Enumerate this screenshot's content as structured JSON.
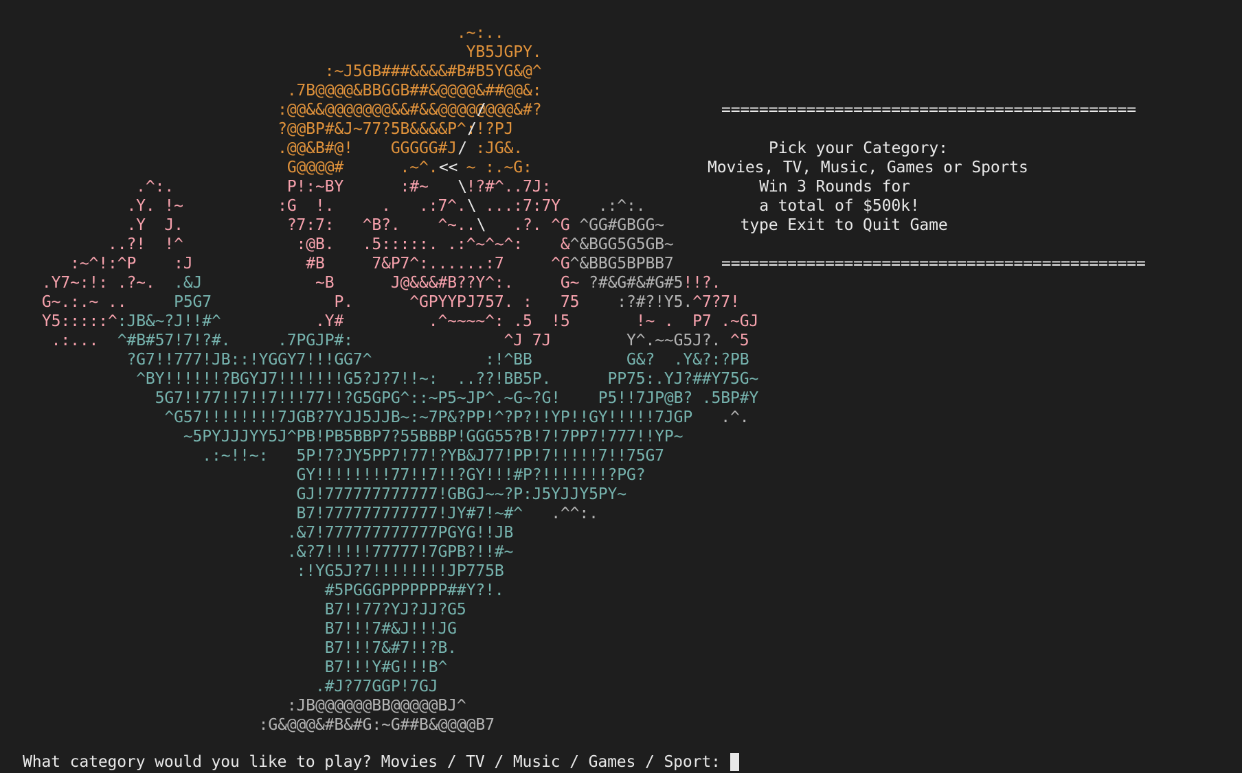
{
  "art_lines": [
    [
      {
        "t": "                                                .~:..",
        "c": "orange"
      }
    ],
    [
      {
        "t": "                                                 YB5JGPY.",
        "c": "orange"
      }
    ],
    [
      {
        "t": "                                  :~J5GB###&&&&#B#B5YG&@^",
        "c": "orange"
      }
    ],
    [
      {
        "t": "                              .7B@@@@&BBGGB##&@@@@&##@@&:",
        "c": "orange"
      }
    ],
    [
      {
        "t": "                             :@@&&@@@@@@@&&#&&@@@@@@@@&#?",
        "c": "orange"
      }
    ],
    [
      {
        "t": "                             ?@@BP#&J~77?5B&&&&P^:!?PJ",
        "c": "orange"
      }
    ],
    [
      {
        "t": "                             .@@&B#@!    GGGGG#J  :JG&.",
        "c": "orange"
      }
    ],
    [
      {
        "t": "                              G@@@@#      .~^.   ~ :.~G:",
        "c": "orange"
      }
    ],
    [
      {
        "t": "              .^:.            P!:~BY      :#~    !?#^..7J:",
        "c": "pink"
      }
    ],
    [
      {
        "t": "             .Y. !~          :G  !.     .   .:7^.  ...:7:7Y    ",
        "c": "pink"
      },
      {
        "t": ".:^:.",
        "c": "grey"
      }
    ],
    [
      {
        "t": "             .Y  J.           ?7:7:   ^B?.    ^~..    .?. ^G ",
        "c": "pink"
      },
      {
        "t": "^GG#GBGG~",
        "c": "grey"
      }
    ],
    [
      {
        "t": "           ..?!  !^            :@B.   .5:::::. .:^~^~^:    &",
        "c": "pink"
      },
      {
        "t": "^&BGG5G5GB~",
        "c": "grey"
      }
    ],
    [
      {
        "t": "       :~^!:^P    :J            #B     7&P7^:......:7     ^G",
        "c": "pink"
      },
      {
        "t": "^&BBG5BPBB7",
        "c": "grey"
      }
    ],
    [
      {
        "t": "    .Y7~:!: .?~.  ",
        "c": "pink"
      },
      {
        "t": ".&J",
        "c": "teal"
      },
      {
        "t": "            ~B      J@&&&#B??Y^:.     G~ ",
        "c": "pink"
      },
      {
        "t": "?#&G#&#G#5",
        "c": "grey"
      },
      {
        "t": "!!?.",
        "c": "pink"
      }
    ],
    [
      {
        "t": "    G~.:.~ ..     ",
        "c": "pink"
      },
      {
        "t": "P5G7",
        "c": "teal"
      },
      {
        "t": "             P.      ^GPYYPJ757. :   75    ",
        "c": "pink"
      },
      {
        "t": ":?#?!Y5.",
        "c": "grey"
      },
      {
        "t": "^7?7!",
        "c": "pink"
      }
    ],
    [
      {
        "t": "    Y5:::::^",
        "c": "pink"
      },
      {
        "t": ":JB&~?J!!#^",
        "c": "teal"
      },
      {
        "t": "          .Y#         .^~~~~^: .5  !5       !~ .  P7 ",
        "c": "pink"
      },
      {
        "t": ".~GJ",
        "c": "pink"
      }
    ],
    [
      {
        "t": "     .:...  ",
        "c": "pink"
      },
      {
        "t": "^#B#57!7!?#.     .7PGJP#:",
        "c": "teal"
      },
      {
        "t": "                ^J 7J        ",
        "c": "pink"
      },
      {
        "t": "Y^.~~G5J?. ",
        "c": "grey"
      },
      {
        "t": "^5",
        "c": "pink"
      }
    ],
    [
      {
        "t": "             ?G7!!777!JB::!YGGY7!!!GG7^            :!^BB          G&?  .Y&?:?PB",
        "c": "teal"
      }
    ],
    [
      {
        "t": "              ^BY!!!!!!?BGYJ7!!!!!!!G5?J?7!!~:  ..??!BB5P.      PP75:.YJ?##Y75G~",
        "c": "teal"
      }
    ],
    [
      {
        "t": "                5G7!!77!!7!!7!!!77!!?G5GPG^::~P5~JP^.~G~?G!    P5!!7JP@B? .5BP#Y",
        "c": "teal"
      }
    ],
    [
      {
        "t": "                 ^G57!!!!!!!!7JGB?7YJJ5JJB~:~7P&?PP!^?P?!!YP!!GY!!!!!7JGP   ",
        "c": "teal"
      },
      {
        "t": ".^.",
        "c": "grey"
      }
    ],
    [
      {
        "t": "                   ~5PYJJJYY5J^PB!PB5BBP7?55BBBP!GGG55?B!7!7PP7!777!!YP~",
        "c": "teal"
      }
    ],
    [
      {
        "t": "                     .:~!!~:   5P!7?JY5PP7!77!?YB&J77!PP!7!!!!!7!!75G7",
        "c": "teal"
      }
    ],
    [
      {
        "t": "                               GY!!!!!!!!77!!7!!?GY!!!#P?!!!!!!!?PG?",
        "c": "teal"
      }
    ],
    [
      {
        "t": "                               GJ!777777777777!GBGJ~~?P:J5YJJY5PY~",
        "c": "teal"
      }
    ],
    [
      {
        "t": "                               B7!777777777777!JY#7!~#^   ",
        "c": "teal"
      },
      {
        "t": ".^^:.",
        "c": "grey"
      }
    ],
    [
      {
        "t": "                              .&7!777777777777PGYG!!JB",
        "c": "teal"
      }
    ],
    [
      {
        "t": "                              .&?7!!!!!77777!7GPB?!!#~",
        "c": "teal"
      }
    ],
    [
      {
        "t": "                               :!YG5J?7!!!!!!!!JP775B",
        "c": "teal"
      }
    ],
    [
      {
        "t": "                                  #5PGGGPPPPPPP##Y?!.",
        "c": "teal"
      }
    ],
    [
      {
        "t": "                                  B7!!77?YJ?JJ?G5",
        "c": "teal"
      }
    ],
    [
      {
        "t": "                                  B7!!!7#&J!!!JG",
        "c": "teal"
      }
    ],
    [
      {
        "t": "                                  B7!!!7&#7!!?B.",
        "c": "teal"
      }
    ],
    [
      {
        "t": "                                  B7!!!Y#G!!!B^",
        "c": "teal"
      }
    ],
    [
      {
        "t": "                                 .#J?77GGP!7GJ",
        "c": "teal"
      }
    ],
    [
      {
        "t": "                              :JB@@@@@@BB@@@@@BJ^",
        "c": "grey"
      }
    ],
    [
      {
        "t": "                           :G&@@@&#B&#G:~G##B&@@@@B7",
        "c": "grey"
      }
    ]
  ],
  "speech_bubble_lines": [
    "                                             /  ============================================",
    "                                            /",
    "                                           /              Pick your Category:",
    "                                         <<           Movies, TV, Music, Games or Sports",
    "                                           \\                Win 3 Rounds for",
    "                                            \\              a total of $500k!",
    "                                             \\           type Exit to Quit Game",
    "                                                ============================================="
  ],
  "banner": {
    "rule_top": "============================================",
    "title": "Pick your Category:",
    "categories": "Movies, TV, Music, Games or Sports",
    "rounds": "Win 3 Rounds for",
    "prize": "a total of $500k!",
    "exit_hint": "type Exit to Quit Game",
    "rule_bottom": "============================================="
  },
  "prompt": {
    "text": "What category would you like to play? Movies / TV / Music / Games / Sport:"
  },
  "colors": {
    "background": "#1e1e1e",
    "orange": "#e0923b",
    "pink": "#f7a2ad",
    "teal": "#76b3ae",
    "grey": "#b4b4b4",
    "white": "#e8e8e8"
  }
}
